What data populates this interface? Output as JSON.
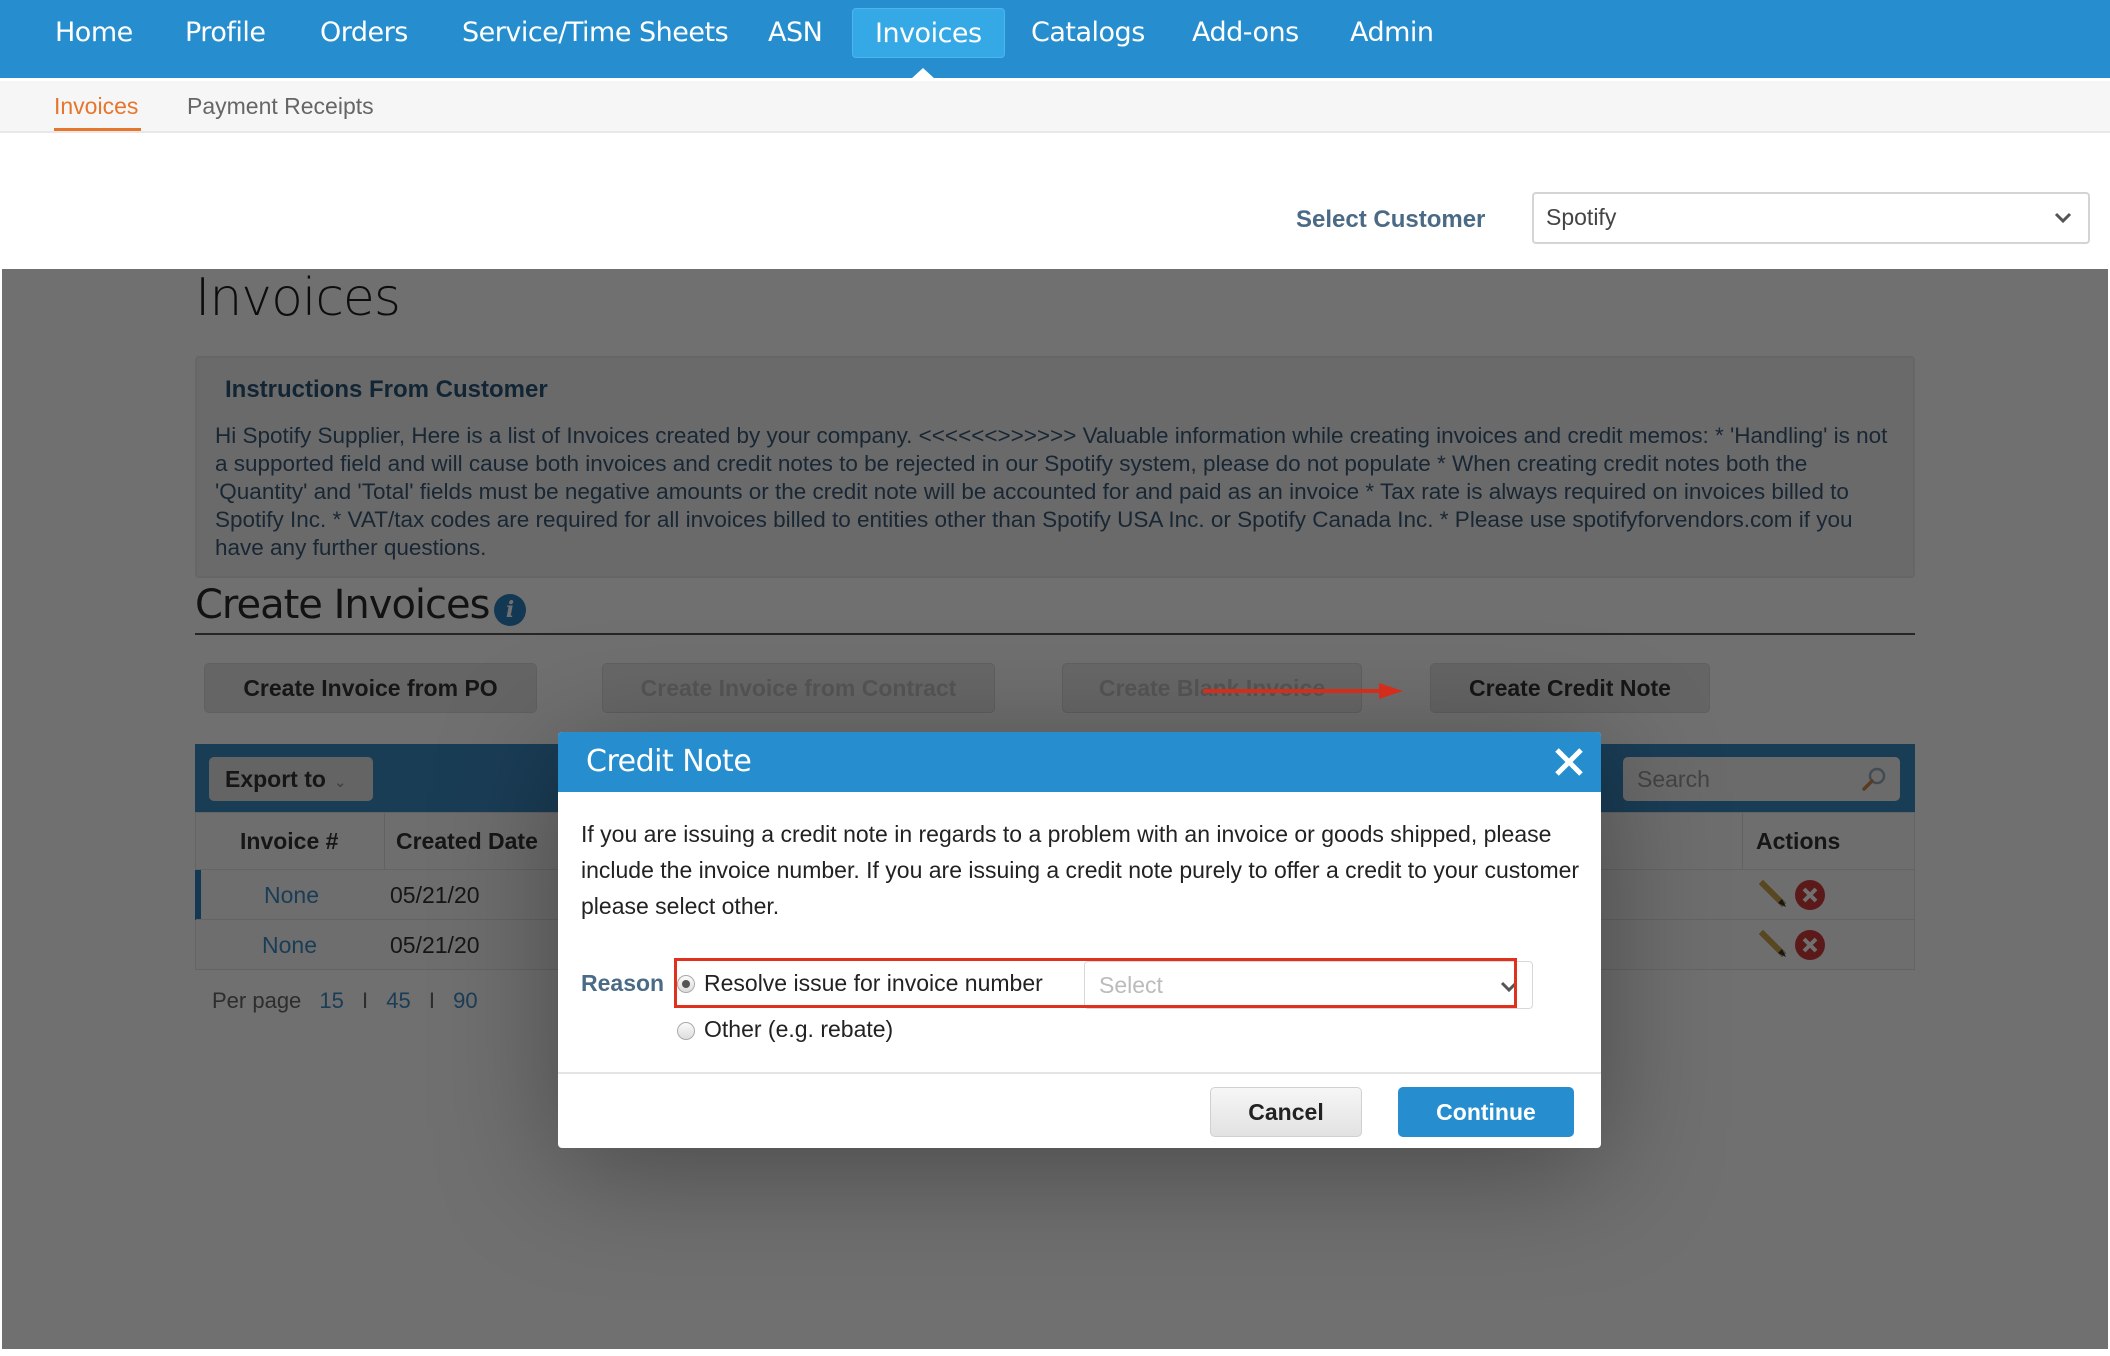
{
  "topnav": {
    "items": [
      "Home",
      "Profile",
      "Orders",
      "Service/Time Sheets",
      "ASN",
      "Invoices",
      "Catalogs",
      "Add-ons",
      "Admin"
    ],
    "active": "Invoices"
  },
  "subnav": {
    "items": [
      "Invoices",
      "Payment Receipts"
    ],
    "active": "Invoices"
  },
  "customer": {
    "label": "Select Customer",
    "value": "Spotify"
  },
  "page": {
    "title": "Invoices",
    "instructions": {
      "title": "Instructions From Customer",
      "text": "Hi Spotify Supplier, Here is a list of Invoices created by your company. <<<<<<>>>>>> Valuable information while creating invoices and credit memos: * 'Handling' is not a supported field and will cause both invoices and credit notes to be rejected in our Spotify system, please do not populate * When creating credit notes both the 'Quantity' and 'Total' fields must be negative amounts or the credit note will be accounted for and paid as an invoice * Tax rate is always required on invoices billed to Spotify Inc. * VAT/tax codes are required for all invoices billed to entities other than Spotify USA Inc. or Spotify Canada Inc. * Please use spotifyforvendors.com if you have any further questions."
    },
    "create_section": {
      "title": "Create Invoices",
      "info_icon": "i",
      "buttons": [
        {
          "label": "Create Invoice from PO",
          "enabled": true
        },
        {
          "label": "Create Invoice from Contract",
          "enabled": false
        },
        {
          "label": "Create Blank Invoice",
          "enabled": false
        },
        {
          "label": "Create Credit Note",
          "enabled": true
        }
      ]
    },
    "grid": {
      "export_label": "Export to",
      "search_placeholder": "Search",
      "columns": [
        "Invoice #",
        "Created Date",
        "Actions"
      ],
      "rows": [
        {
          "invoice": "None",
          "created": "05/21/20"
        },
        {
          "invoice": "None",
          "created": "05/21/20"
        }
      ],
      "per_page_label": "Per page",
      "per_page_options": [
        "15",
        "45",
        "90"
      ],
      "per_page_sep": "I"
    }
  },
  "modal": {
    "title": "Credit Note",
    "body": "If you are issuing a credit note in regards to a problem with an invoice or goods shipped, please include the invoice number. If you are issuing a credit note purely to offer a credit to your customer please select other.",
    "reason_label": "Reason",
    "options": [
      {
        "label": "Resolve issue for invoice number",
        "checked": true
      },
      {
        "label": "Other (e.g. rebate)",
        "checked": false
      }
    ],
    "invoice_select_placeholder": "Select",
    "cancel_label": "Cancel",
    "continue_label": "Continue"
  },
  "colors": {
    "brand_blue": "#268ecf",
    "active_orange": "#e6762c",
    "annotation_red": "#e0301e"
  }
}
